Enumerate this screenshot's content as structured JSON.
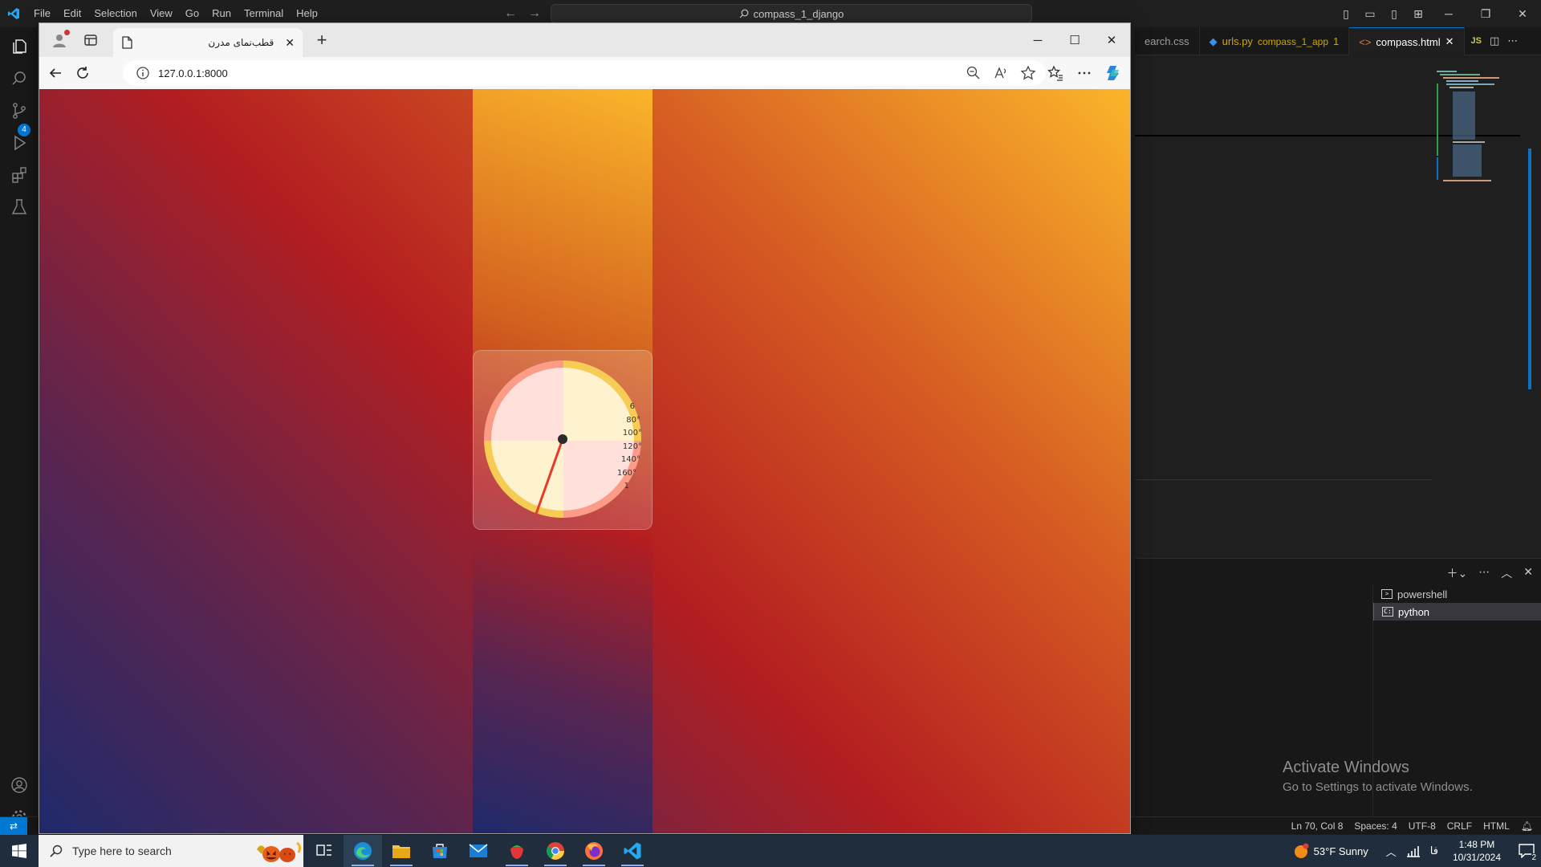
{
  "vscode": {
    "menu": [
      "File",
      "Edit",
      "Selection",
      "View",
      "Go",
      "Run",
      "Terminal",
      "Help"
    ],
    "command_center": "compass_1_django",
    "tabs": [
      {
        "label": "earch.css",
        "sub": "",
        "active": false
      },
      {
        "label": "urls.py",
        "sub": "compass_1_app",
        "mod": "1",
        "active": false
      },
      {
        "label": "compass.html",
        "sub": "",
        "active": true
      }
    ],
    "tab_js_badge": "JS",
    "scm_badge": "4",
    "terminals": [
      "powershell",
      "python"
    ],
    "activate": {
      "title": "Activate Windows",
      "subtitle": "Go to Settings to activate Windows."
    },
    "status": {
      "position": "Ln 70, Col 8",
      "spaces": "Spaces: 4",
      "encoding": "UTF-8",
      "eol": "CRLF",
      "language": "HTML"
    }
  },
  "browser": {
    "tab_title": "قطب‌نمای مدرن",
    "url": "127.0.0.1:8000",
    "compass": {
      "labels": [
        "6",
        "80°",
        "100°",
        "120°",
        "140°",
        "160°",
        "1"
      ],
      "needle_color": "#e8392b",
      "ring_colors": [
        "#f7cc55",
        "#fb9c86"
      ],
      "face_colors": [
        "#fff2cf",
        "#ffe0da"
      ]
    }
  },
  "taskbar": {
    "search_placeholder": "Type here to search",
    "weather": "53°F  Sunny",
    "lang": "فا",
    "time": "1:48 PM",
    "date": "10/31/2024",
    "notifications": "2"
  }
}
